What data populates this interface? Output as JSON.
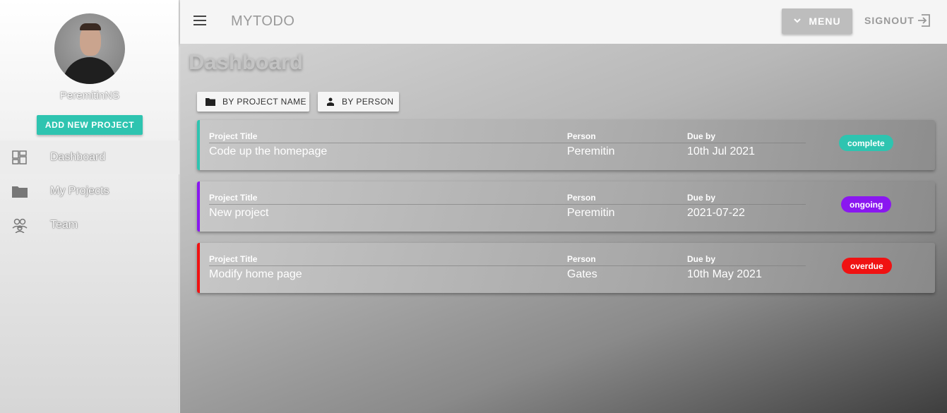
{
  "sidebar": {
    "username": "PeremitinNS",
    "add_project_label": "ADD NEW PROJECT",
    "nav": [
      {
        "label": "Dashboard",
        "icon": "dashboard-icon"
      },
      {
        "label": "My Projects",
        "icon": "folder-icon"
      },
      {
        "label": "Team",
        "icon": "team-icon"
      }
    ]
  },
  "topbar": {
    "app_title": "MYTODO",
    "menu_label": "MENU",
    "signout_label": "SIGNOUT"
  },
  "main": {
    "page_title": "Dashboard",
    "sort_by_project_label": "BY PROJECT NAME",
    "sort_by_person_label": "BY PERSON",
    "field_labels": {
      "title": "Project Title",
      "person": "Person",
      "due": "Due by"
    },
    "projects": [
      {
        "title": "Code up the homepage",
        "person": "Peremitin",
        "due": "10th Jul 2021",
        "status": "complete",
        "color": "#2ec4b0"
      },
      {
        "title": "New project",
        "person": "Peremitin",
        "due": "2021-07-22",
        "status": "ongoing",
        "color": "#8a17f0"
      },
      {
        "title": "Modify home page",
        "person": "Gates",
        "due": "10th May 2021",
        "status": "overdue",
        "color": "#f01212"
      }
    ]
  },
  "colors": {
    "accent": "#2ec4b0"
  }
}
